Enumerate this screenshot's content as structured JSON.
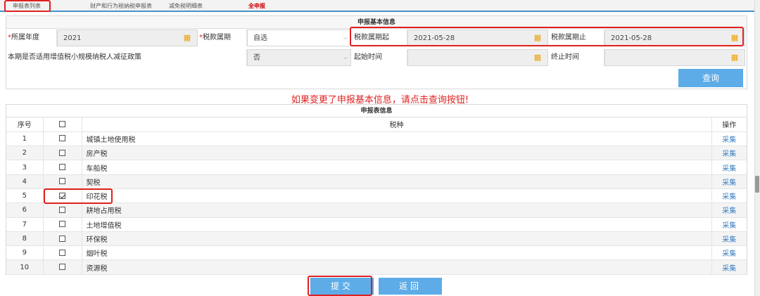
{
  "tabs": {
    "list": "申报表列表",
    "property": "财产和行为税纳税申报表",
    "relief": "减免税明细表",
    "all": "全申报"
  },
  "basic_info": {
    "title": "申报基本信息",
    "year_label": "所属年度",
    "year_value": "2021",
    "period_label": "税款属期",
    "period_value": "自选",
    "period_start_label": "税款属期起",
    "period_start_value": "2021-05-28",
    "period_end_label": "税款属期止",
    "period_end_value": "2021-05-28",
    "policy_label": "本期是否适用增值税小规模纳税人减征政策",
    "policy_value": "否",
    "start_time_label": "起始时间",
    "end_time_label": "终止时间",
    "query_button": "查询"
  },
  "notice": "如果变更了申报基本信息，请点击查询按钮!",
  "table": {
    "title": "申报表信息",
    "headers": {
      "no": "序号",
      "tax": "税种",
      "op": "操作"
    },
    "rows": [
      {
        "no": "1",
        "name": "城镇土地使用税",
        "checked": false,
        "op": "采集"
      },
      {
        "no": "2",
        "name": "房产税",
        "checked": false,
        "op": "采集"
      },
      {
        "no": "3",
        "name": "车船税",
        "checked": false,
        "op": "采集"
      },
      {
        "no": "4",
        "name": "契税",
        "checked": false,
        "op": "采集"
      },
      {
        "no": "5",
        "name": "印花税",
        "checked": true,
        "op": "采集"
      },
      {
        "no": "6",
        "name": "耕地占用税",
        "checked": false,
        "op": "采集"
      },
      {
        "no": "7",
        "name": "土地增值税",
        "checked": false,
        "op": "采集"
      },
      {
        "no": "8",
        "name": "环保税",
        "checked": false,
        "op": "采集"
      },
      {
        "no": "9",
        "name": "烟叶税",
        "checked": false,
        "op": "采集"
      },
      {
        "no": "10",
        "name": "资源税",
        "checked": false,
        "op": "采集"
      }
    ]
  },
  "buttons": {
    "submit": "提交",
    "back": "返回"
  },
  "colors": {
    "accent": "#5dace8",
    "highlight": "#e02020",
    "link": "#3c7fc4",
    "calendar": "#f0a000"
  }
}
